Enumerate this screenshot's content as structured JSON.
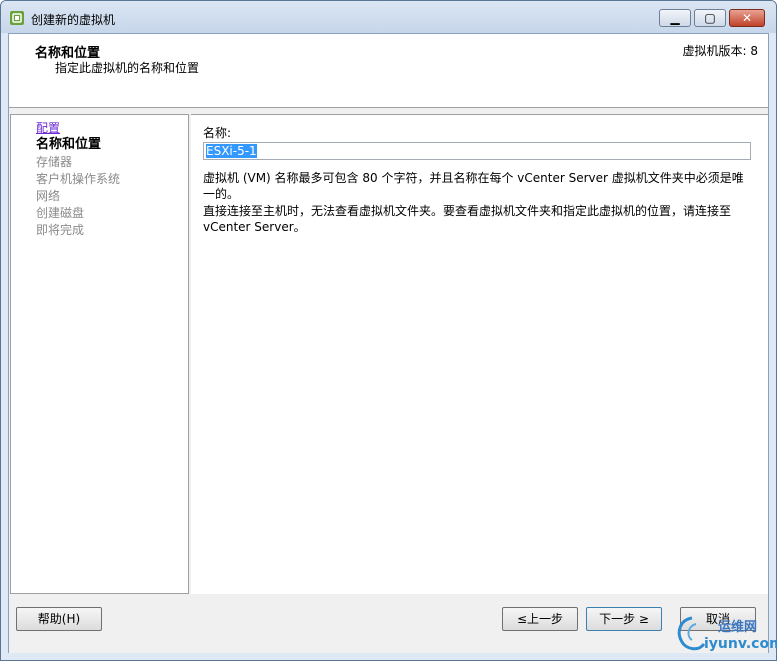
{
  "window": {
    "title": "创建新的虚拟机",
    "min_label": "▁",
    "max_label": "▢",
    "close_label": "✕"
  },
  "header": {
    "title": "名称和位置",
    "subtitle": "指定此虚拟机的名称和位置",
    "version": "虚拟机版本: 8"
  },
  "nav": {
    "items": [
      {
        "label": "配置",
        "state": "link"
      },
      {
        "label": "名称和位置",
        "state": "current"
      },
      {
        "label": "存储器",
        "state": "disabled"
      },
      {
        "label": "客户机操作系统",
        "state": "disabled"
      },
      {
        "label": "网络",
        "state": "disabled"
      },
      {
        "label": "创建磁盘",
        "state": "disabled"
      },
      {
        "label": "即将完成",
        "state": "disabled"
      }
    ]
  },
  "form": {
    "name_label": "名称:",
    "name_value": "ESXi-5-1",
    "info1": "虚拟机 (VM) 名称最多可包含 80 个字符，并且名称在每个 vCenter Server 虚拟机文件夹中必须是唯一的。",
    "info2": "直接连接至主机时，无法查看虚拟机文件夹。要查看虚拟机文件夹和指定此虚拟机的位置，请连接至 vCenter Server。"
  },
  "footer": {
    "help": "帮助(H)",
    "back": "≤上一步",
    "next": "下一步 ≥",
    "cancel": "取消"
  },
  "watermark": {
    "cn": "运维网",
    "en": "iyunv.com"
  },
  "colors": {
    "accent": "#3399ff",
    "link": "#6a2ad4",
    "disabled_text": "#8a8a8a"
  }
}
